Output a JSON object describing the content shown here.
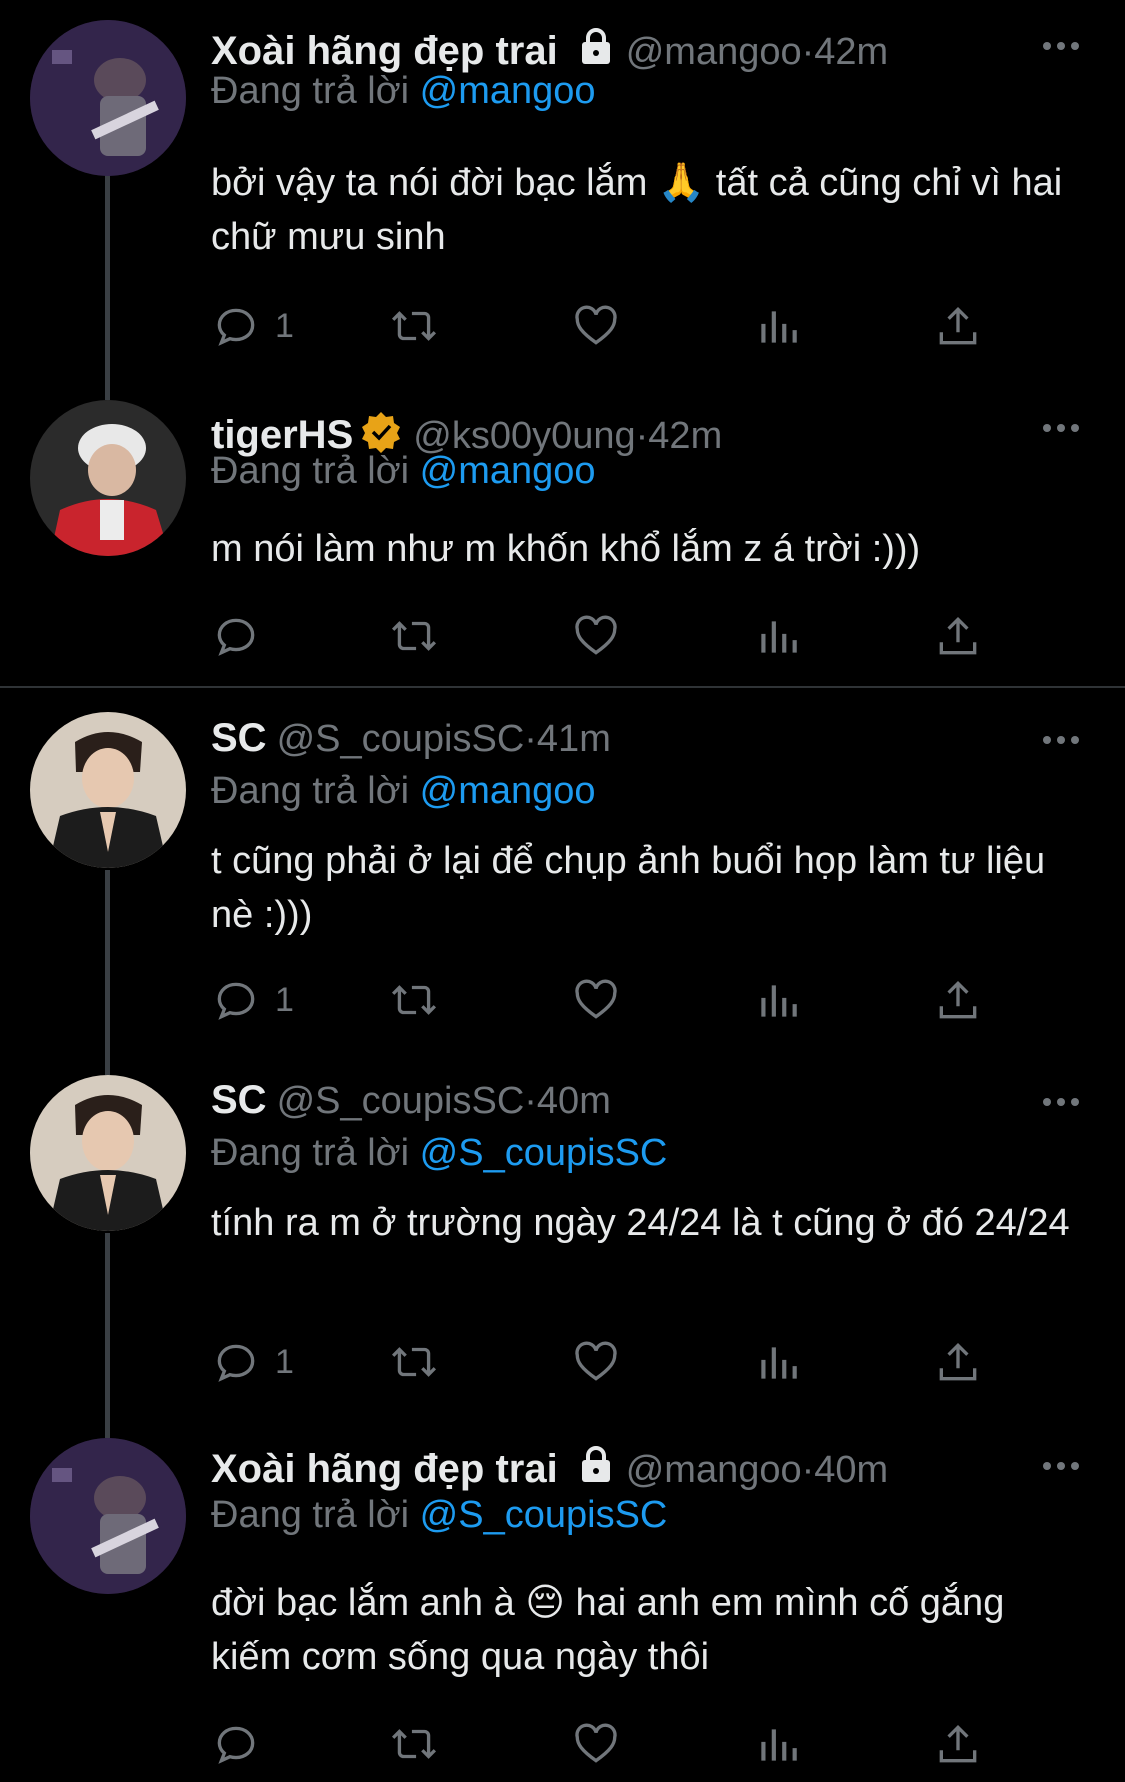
{
  "tweets": [
    {
      "name": "Xoài hãng đẹp trai",
      "handle": "@mangoo",
      "time": "42m",
      "reply_prefix": "Đang trả lời",
      "reply_to": "@mangoo",
      "text": "bởi vậy ta nói đời bạc lắm 🙏  tất cả cũng chỉ vì hai chữ mưu sinh",
      "reply_count": "1",
      "badge": "lock-icon"
    },
    {
      "name": "tigerHS",
      "handle": "@ks00y0ung",
      "time": "42m",
      "reply_prefix": "Đang trả lời",
      "reply_to": "@mangoo",
      "text": "m nói làm như m khốn khổ lắm z á trời :)))",
      "reply_count": "",
      "badge": "verified-icon"
    },
    {
      "name": "SC",
      "handle": "@S_coupisSC",
      "time": "41m",
      "reply_prefix": "Đang trả lời",
      "reply_to": "@mangoo",
      "text": "t cũng phải ở lại để chụp ảnh buổi họp làm tư liệu nè :)))",
      "reply_count": "1",
      "badge": ""
    },
    {
      "name": "SC",
      "handle": "@S_coupisSC",
      "time": "40m",
      "reply_prefix": "Đang trả lời",
      "reply_to": "@S_coupisSC",
      "text": "tính ra m ở trường ngày 24/24 là t cũng ở đó 24/24",
      "reply_count": "1",
      "badge": ""
    },
    {
      "name": "Xoài hãng đẹp trai",
      "handle": "@mangoo",
      "time": "40m",
      "reply_prefix": "Đang trả lời",
      "reply_to": "@S_coupisSC",
      "text": "đời bạc lắm anh à 😔  hai anh em mình cố gắng kiếm cơm sống qua ngày thôi",
      "reply_count": "",
      "badge": "lock-icon"
    }
  ],
  "separator": " · ",
  "colors": {
    "background": "#000000",
    "text": "#e7e9ea",
    "secondary": "#71767b",
    "mention": "#1d9bf0",
    "verified": "#e8a317"
  }
}
